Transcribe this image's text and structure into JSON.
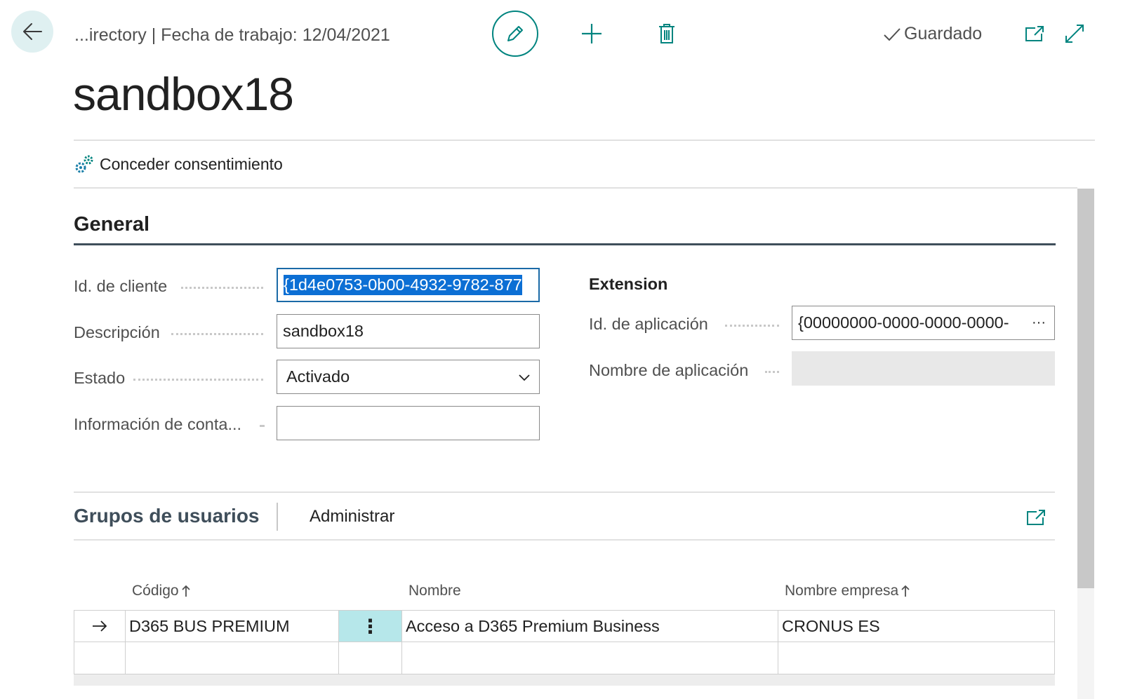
{
  "header": {
    "breadcrumb": "...irectory | Fecha de trabajo: 12/04/2021",
    "saved_label": "Guardado",
    "icons": {
      "back": "back-arrow-icon",
      "edit": "pencil-icon",
      "new": "plus-icon",
      "delete": "trash-icon",
      "saved": "checkmark-icon",
      "open_new_window": "open-in-new-window-icon",
      "expand": "expand-icon"
    }
  },
  "page": {
    "title": "sandbox18"
  },
  "actions": {
    "grant_consent": "Conceder consentimiento",
    "grant_consent_icon": "gears-icon"
  },
  "general": {
    "title": "General",
    "fields": {
      "client_id": {
        "label": "Id. de cliente",
        "value": "{1d4e0753-0b00-4932-9782-877"
      },
      "description": {
        "label": "Descripción",
        "value": "sandbox18"
      },
      "state": {
        "label": "Estado",
        "value": "Activado"
      },
      "contact_info": {
        "label": "Información de conta...",
        "value": ""
      }
    },
    "extension": {
      "title": "Extension",
      "app_id": {
        "label": "Id. de aplicación",
        "value": "{00000000-0000-0000-0000-",
        "more": "···"
      },
      "app_name": {
        "label": "Nombre de aplicación",
        "value": ""
      }
    }
  },
  "user_groups": {
    "title": "Grupos de usuarios",
    "action_manage": "Administrar",
    "columns": {
      "code": "Código",
      "name": "Nombre",
      "company": "Nombre empresa"
    },
    "rows": [
      {
        "code": "D365 BUS PREMIUM",
        "menu": "⋮",
        "name": "Acceso a D365 Premium Business",
        "company": "CRONUS ES"
      },
      {
        "code": "",
        "menu": "",
        "name": "",
        "company": ""
      }
    ]
  },
  "colors": {
    "accent": "#00847f",
    "selection": "#0c6fd4",
    "row_highlight": "#b6e7ea"
  }
}
